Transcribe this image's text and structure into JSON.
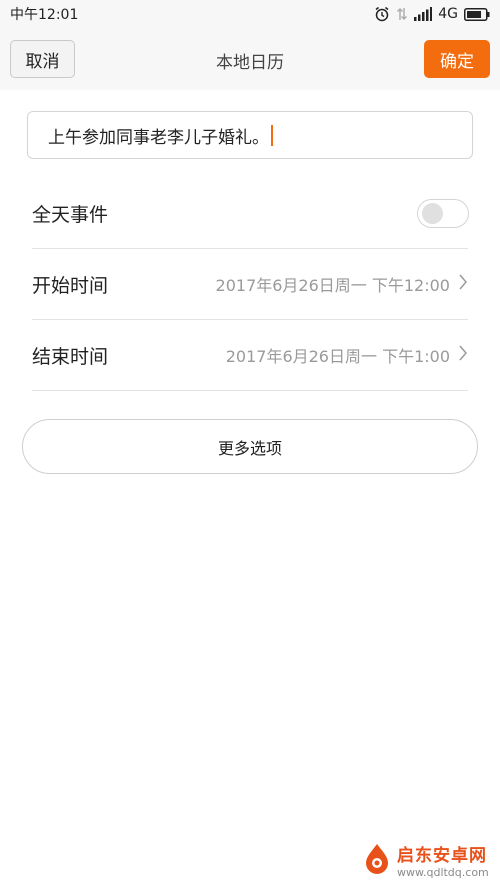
{
  "status_bar": {
    "time": "中午12:01",
    "network": "4G",
    "icons": [
      "alarm-icon",
      "data-transfer-icon",
      "signal-icon",
      "battery-icon"
    ]
  },
  "header": {
    "cancel_label": "取消",
    "title": "本地日历",
    "confirm_label": "确定"
  },
  "event": {
    "title_value": "上午参加同事老李儿子婚礼。"
  },
  "rows": {
    "all_day": {
      "label": "全天事件",
      "enabled": false
    },
    "start": {
      "label": "开始时间",
      "value": "2017年6月26日周一 下午12:00"
    },
    "end": {
      "label": "结束时间",
      "value": "2017年6月26日周一 下午1:00"
    }
  },
  "more_options_label": "更多选项",
  "watermark": {
    "name": "启东安卓网",
    "url": "www.qdltdq.com"
  },
  "colors": {
    "accent": "#f36c0e",
    "header_bg": "#f7f7f7",
    "muted_text": "#9a9a9a"
  }
}
